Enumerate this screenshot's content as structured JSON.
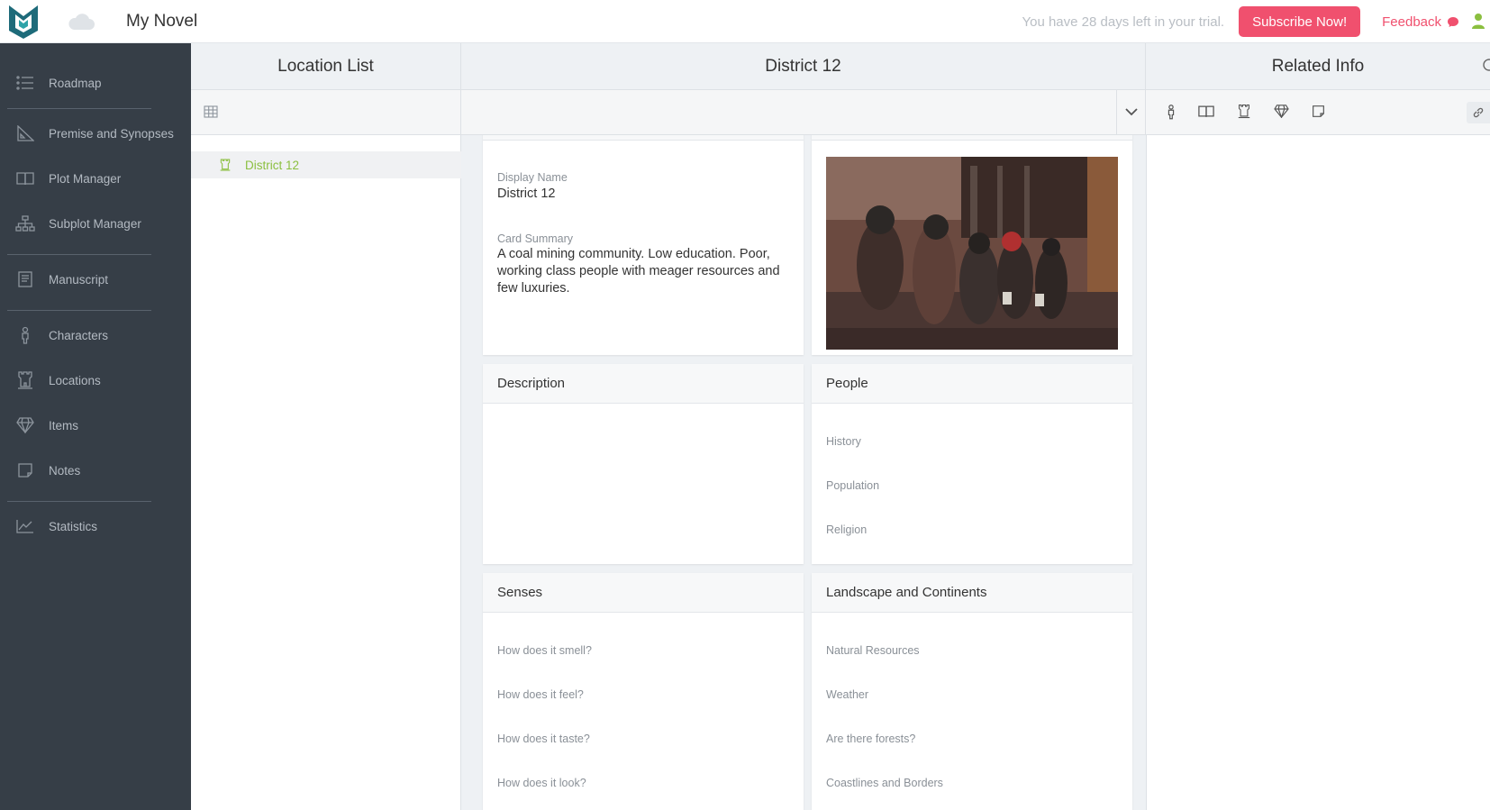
{
  "app": {
    "title": "My Novel",
    "trial_text": "You have 28 days left in your trial.",
    "subscribe_label": "Subscribe Now!",
    "feedback_label": "Feedback",
    "accent_color": "#f0506e",
    "brand_color": "#1e6b7a",
    "active_green": "#8bbf3f"
  },
  "sidebar": {
    "items": [
      {
        "label": "Roadmap",
        "icon": "list-icon"
      },
      {
        "label": "Premise and Synopses",
        "icon": "ruler-icon"
      },
      {
        "label": "Plot Manager",
        "icon": "book-icon"
      },
      {
        "label": "Subplot Manager",
        "icon": "hierarchy-icon"
      },
      {
        "label": "Manuscript",
        "icon": "document-icon"
      },
      {
        "label": "Characters",
        "icon": "person-icon"
      },
      {
        "label": "Locations",
        "icon": "castle-icon"
      },
      {
        "label": "Items",
        "icon": "diamond-icon"
      },
      {
        "label": "Notes",
        "icon": "note-icon"
      },
      {
        "label": "Statistics",
        "icon": "chart-icon"
      }
    ]
  },
  "columns": {
    "list_title": "Location List",
    "detail_title": "District 12",
    "related_title": "Related Info"
  },
  "location_list": {
    "items": [
      {
        "label": "District 12",
        "active": true
      }
    ]
  },
  "detail": {
    "display_name_label": "Display Name",
    "display_name_value": "District 12",
    "card_summary_label": "Card Summary",
    "card_summary_value": "A coal mining community. Low education. Poor, working class people with meager resources and few luxuries.",
    "description_title": "Description",
    "people": {
      "title": "People",
      "prompts": [
        "History",
        "Population",
        "Religion"
      ]
    },
    "senses": {
      "title": "Senses",
      "prompts": [
        "How does it smell?",
        "How does it feel?",
        "How does it taste?",
        "How does it look?"
      ]
    },
    "landscape": {
      "title": "Landscape and Continents",
      "prompts": [
        "Natural Resources",
        "Weather",
        "Are there forests?",
        "Coastlines and Borders"
      ]
    }
  }
}
